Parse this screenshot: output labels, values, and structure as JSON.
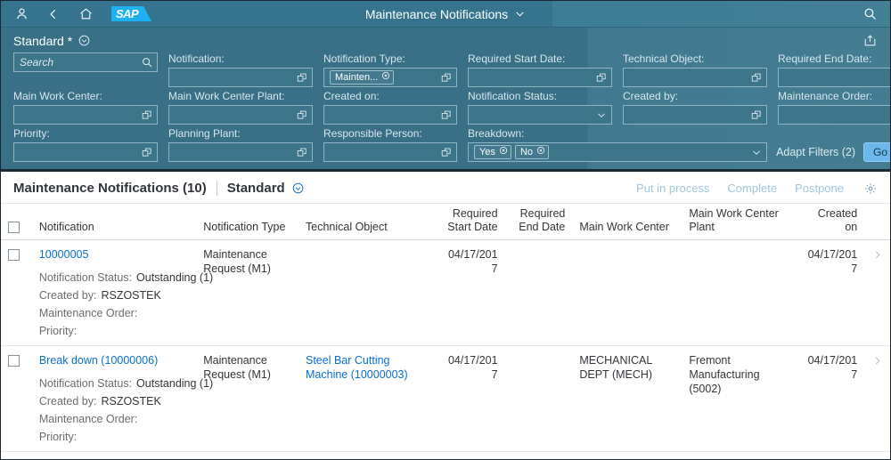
{
  "shell": {
    "icons": {
      "user": "user-icon",
      "back": "back-icon",
      "home": "home-icon",
      "search": "search-icon"
    },
    "logo_text": "SAP",
    "title": "Maintenance Notifications"
  },
  "variant": {
    "name": "Standard *",
    "share_icon": "share-icon"
  },
  "filters": {
    "search": {
      "label": "",
      "placeholder": "Search",
      "value": ""
    },
    "fields": [
      {
        "label": "Notification:",
        "value": "",
        "icon": "value-help-icon",
        "type": "valuehelp"
      },
      {
        "label": "Notification Type:",
        "value": "",
        "icon": "value-help-icon",
        "type": "tokens",
        "tokens": [
          "Mainten..."
        ]
      },
      {
        "label": "Required Start Date:",
        "value": "",
        "icon": "value-help-icon",
        "type": "valuehelp"
      },
      {
        "label": "Technical Object:",
        "value": "",
        "icon": "value-help-icon",
        "type": "valuehelp"
      },
      {
        "label": "Required End Date:",
        "value": "",
        "icon": "value-help-icon",
        "type": "valuehelp"
      },
      {
        "label": "Main Work Center:",
        "value": "",
        "icon": "value-help-icon",
        "type": "valuehelp"
      },
      {
        "label": "Main Work Center Plant:",
        "value": "",
        "icon": "value-help-icon",
        "type": "valuehelp"
      },
      {
        "label": "Created on:",
        "value": "",
        "icon": "value-help-icon",
        "type": "valuehelp"
      },
      {
        "label": "Notification Status:",
        "value": "",
        "icon": "chevron-down-icon",
        "type": "select"
      },
      {
        "label": "Created by:",
        "value": "",
        "icon": "value-help-icon",
        "type": "valuehelp"
      },
      {
        "label": "Maintenance Order:",
        "value": "",
        "icon": "value-help-icon",
        "type": "valuehelp"
      },
      {
        "label": "Priority:",
        "value": "",
        "icon": "value-help-icon",
        "type": "valuehelp"
      },
      {
        "label": "Planning Plant:",
        "value": "",
        "icon": "value-help-icon",
        "type": "valuehelp"
      },
      {
        "label": "Responsible Person:",
        "value": "",
        "icon": "value-help-icon",
        "type": "valuehelp"
      },
      {
        "label": "Breakdown:",
        "value": "",
        "icon": "chevron-down-icon",
        "type": "tokens",
        "tokens": [
          "Yes",
          "No"
        ]
      }
    ],
    "adapt_filters_label": "Adapt Filters (2)",
    "go_label": "Go",
    "pin_icon": "pin-icon"
  },
  "table": {
    "title": "Maintenance Notifications (10)",
    "variant": "Standard",
    "actions": [
      {
        "label": "Put in process"
      },
      {
        "label": "Complete"
      },
      {
        "label": "Postpone"
      }
    ],
    "settings_icon": "gear-icon",
    "columns": [
      {
        "label": "Notification",
        "align": "left"
      },
      {
        "label": "Notification Type",
        "align": "left"
      },
      {
        "label": "Technical Object",
        "align": "left"
      },
      {
        "label": "Required Start Date",
        "align": "right"
      },
      {
        "label": "Required End Date",
        "align": "right"
      },
      {
        "label": "Main Work Center",
        "align": "left"
      },
      {
        "label": "Main Work Center Plant",
        "align": "left"
      },
      {
        "label": "Created on",
        "align": "right"
      }
    ],
    "rows": [
      {
        "notification": "10000005",
        "notification_is_link": true,
        "notification_type": "Maintenance Request (M1)",
        "technical_object": "",
        "technical_object_is_link": false,
        "required_start_date": "04/17/2017",
        "required_end_date": "",
        "main_work_center": "",
        "main_work_center_plant": "",
        "created_on": "04/17/2017",
        "details": [
          {
            "key": "Notification Status:",
            "value": "Outstanding (1)"
          },
          {
            "key": "Created by:",
            "value": "RSZOSTEK"
          },
          {
            "key": "Maintenance Order:",
            "value": ""
          },
          {
            "key": "Priority:",
            "value": ""
          }
        ]
      },
      {
        "notification": "Break down (10000006)",
        "notification_is_link": true,
        "notification_type": "Maintenance Request (M1)",
        "technical_object": "Steel Bar Cutting Machine (10000003)",
        "technical_object_is_link": true,
        "required_start_date": "04/17/2017",
        "required_end_date": "",
        "main_work_center": "MECHANICAL DEPT (MECH)",
        "main_work_center_plant": "Fremont Manufacturing (5002)",
        "created_on": "04/17/2017",
        "details": [
          {
            "key": "Notification Status:",
            "value": "Outstanding (1)"
          },
          {
            "key": "Created by:",
            "value": "RSZOSTEK"
          },
          {
            "key": "Maintenance Order:",
            "value": ""
          },
          {
            "key": "Priority:",
            "value": ""
          }
        ]
      }
    ]
  },
  "colors": {
    "shell_bg": "#35748c",
    "filterbar_bg": "#3a7086",
    "accent_link": "#0a6ed1",
    "go_button": "#6ab8ec",
    "sap_logo": "#1fb0ef"
  }
}
